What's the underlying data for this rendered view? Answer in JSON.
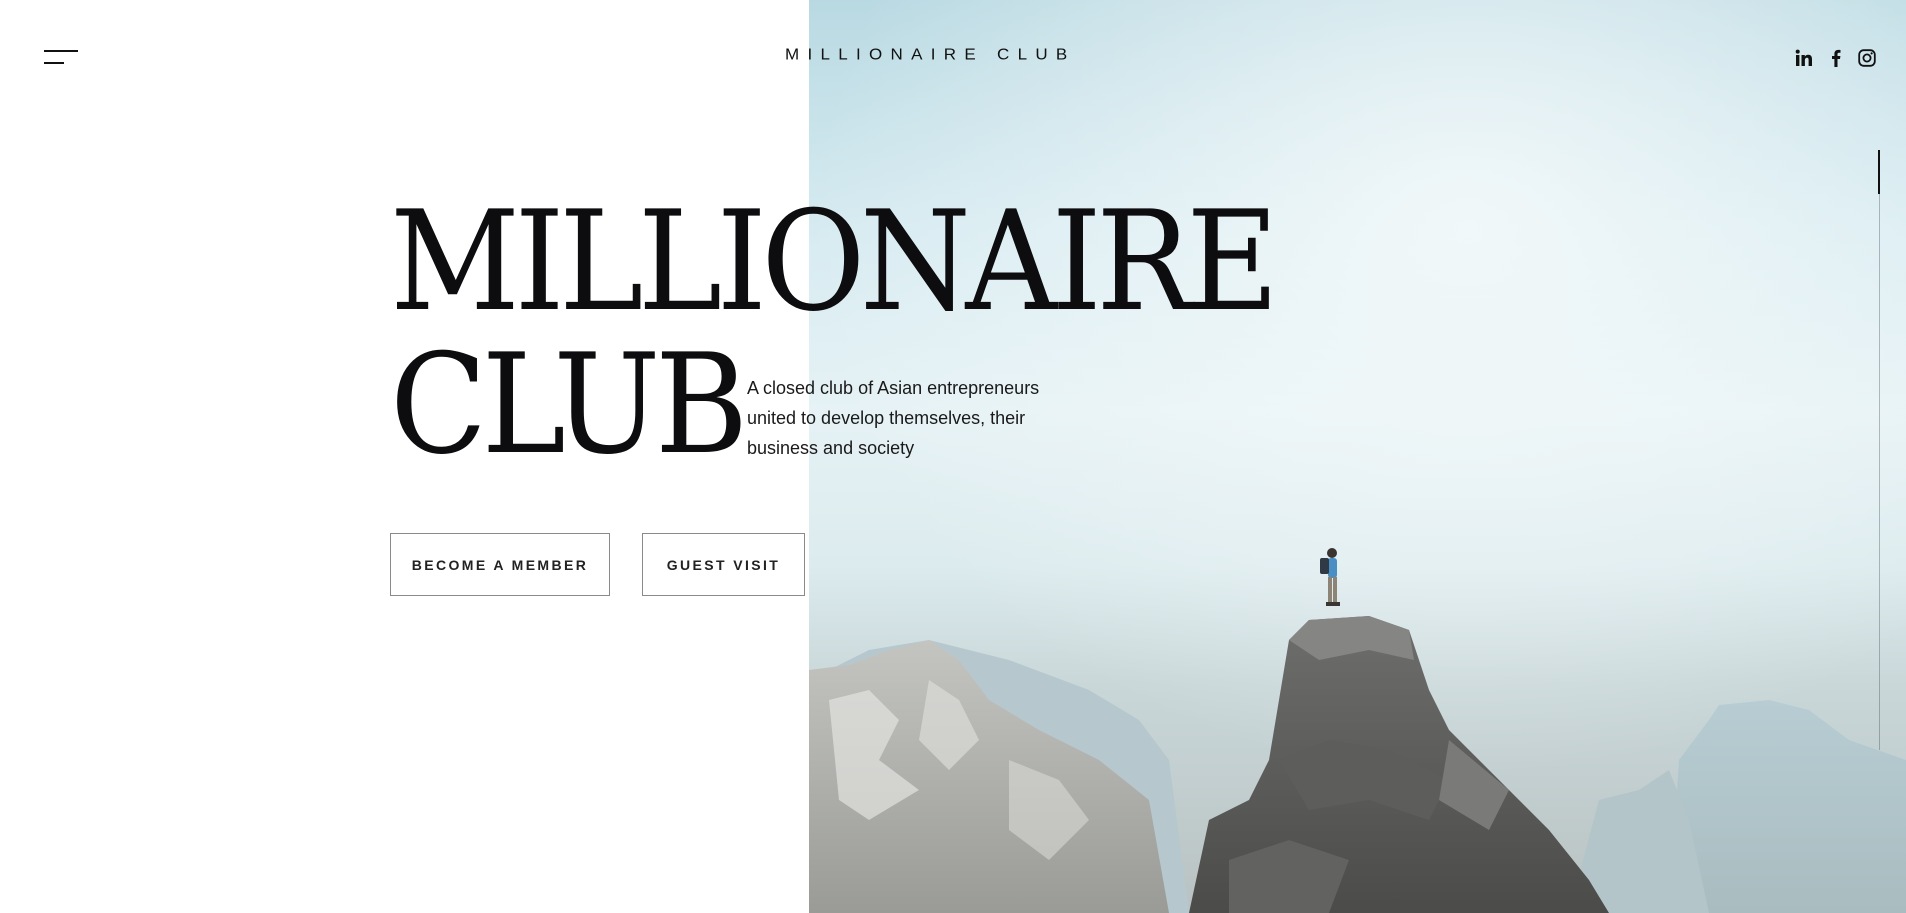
{
  "header": {
    "logo": "MILLIONAIRE CLUB",
    "menu_icon": "hamburger-menu-icon",
    "social": [
      {
        "name": "linkedin-icon",
        "label": "in"
      },
      {
        "name": "facebook-icon",
        "label": "f"
      },
      {
        "name": "instagram-icon",
        "label": ""
      }
    ]
  },
  "hero": {
    "headline_line1": "MILLIONAIRE",
    "headline_line2": "CLUB",
    "intro": "A closed club of Asian entrepreneurs united to develop themselves, their business and society",
    "primary_button": "BECOME A MEMBER",
    "secondary_button": "GUEST VISIT"
  },
  "colors": {
    "text": "#111111",
    "background": "#ffffff",
    "button_border": "#8a8a8a",
    "sky": "#d6ebf1"
  },
  "scroll_progress": 0.07
}
